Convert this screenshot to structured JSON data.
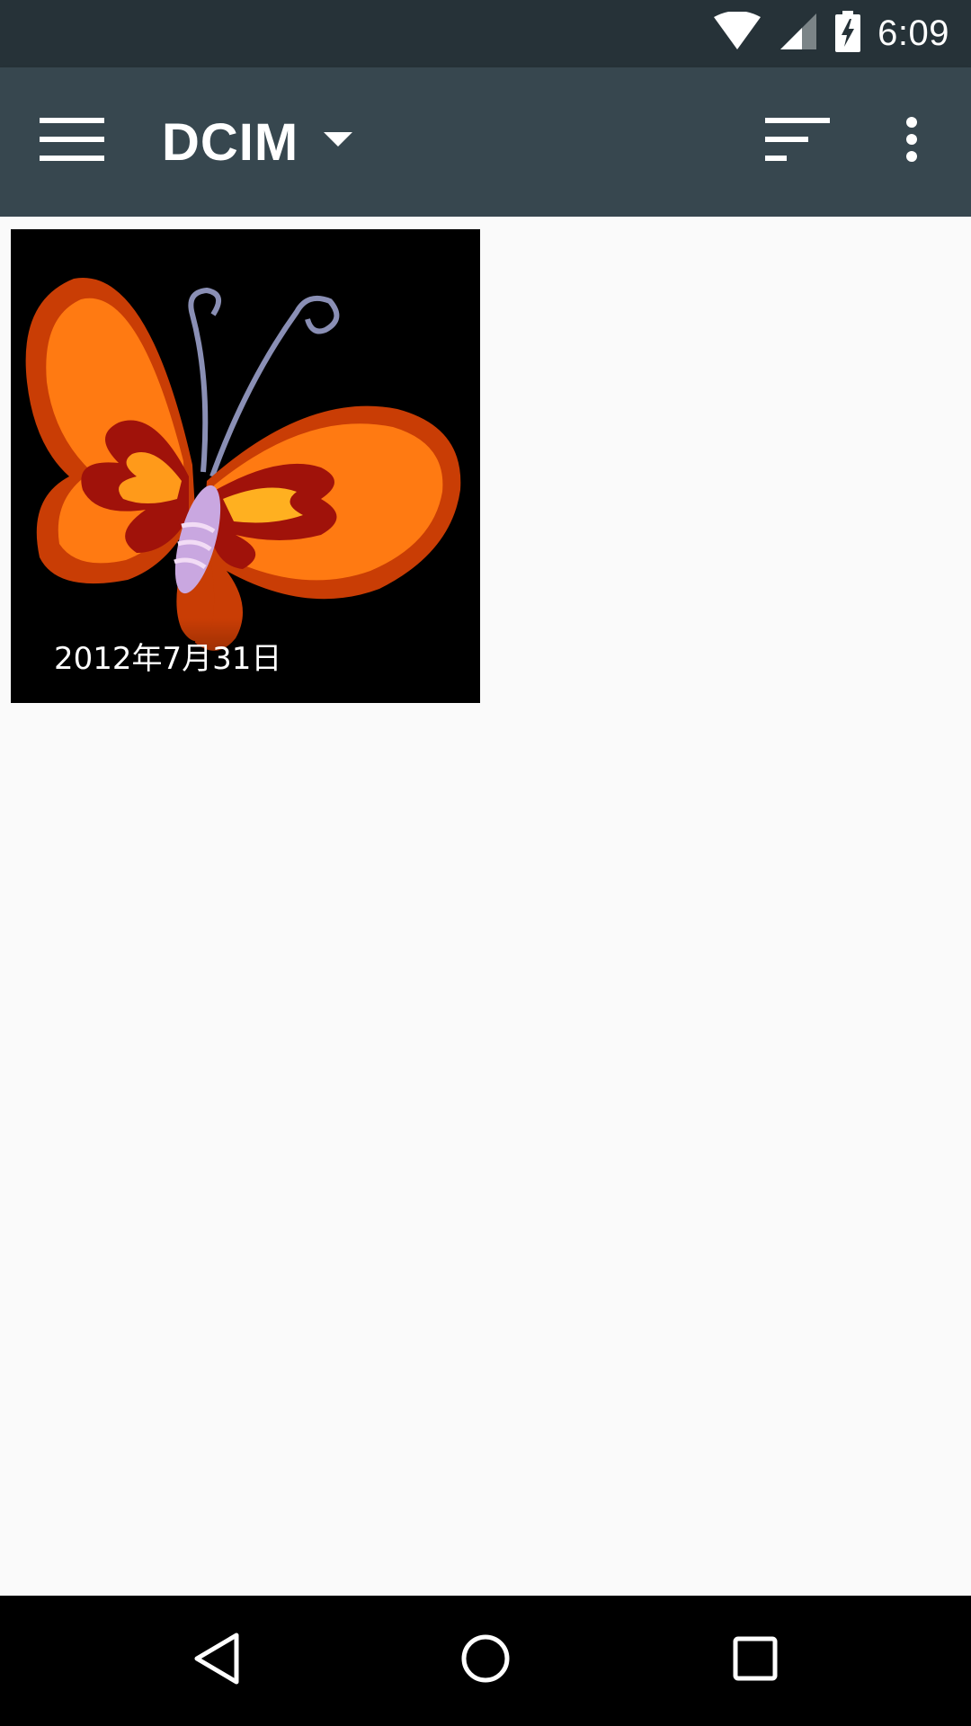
{
  "status_bar": {
    "time": "6:09",
    "icons": [
      "wifi-icon",
      "cell-signal-icon",
      "battery-charging-icon"
    ]
  },
  "app_bar": {
    "title": "DCIM",
    "icons": [
      "menu-icon",
      "dropdown-arrow-icon",
      "sort-icon",
      "more-vert-icon"
    ]
  },
  "grid": {
    "items": [
      {
        "caption": "2012年7月31日",
        "image": "butterfly-image"
      }
    ]
  },
  "nav_bar": {
    "icons": [
      "back-icon",
      "home-icon",
      "recents-icon"
    ]
  },
  "colors": {
    "status_bar": "#263238",
    "app_bar": "#37474f",
    "background": "#fafafa",
    "nav_bar": "#000000"
  }
}
